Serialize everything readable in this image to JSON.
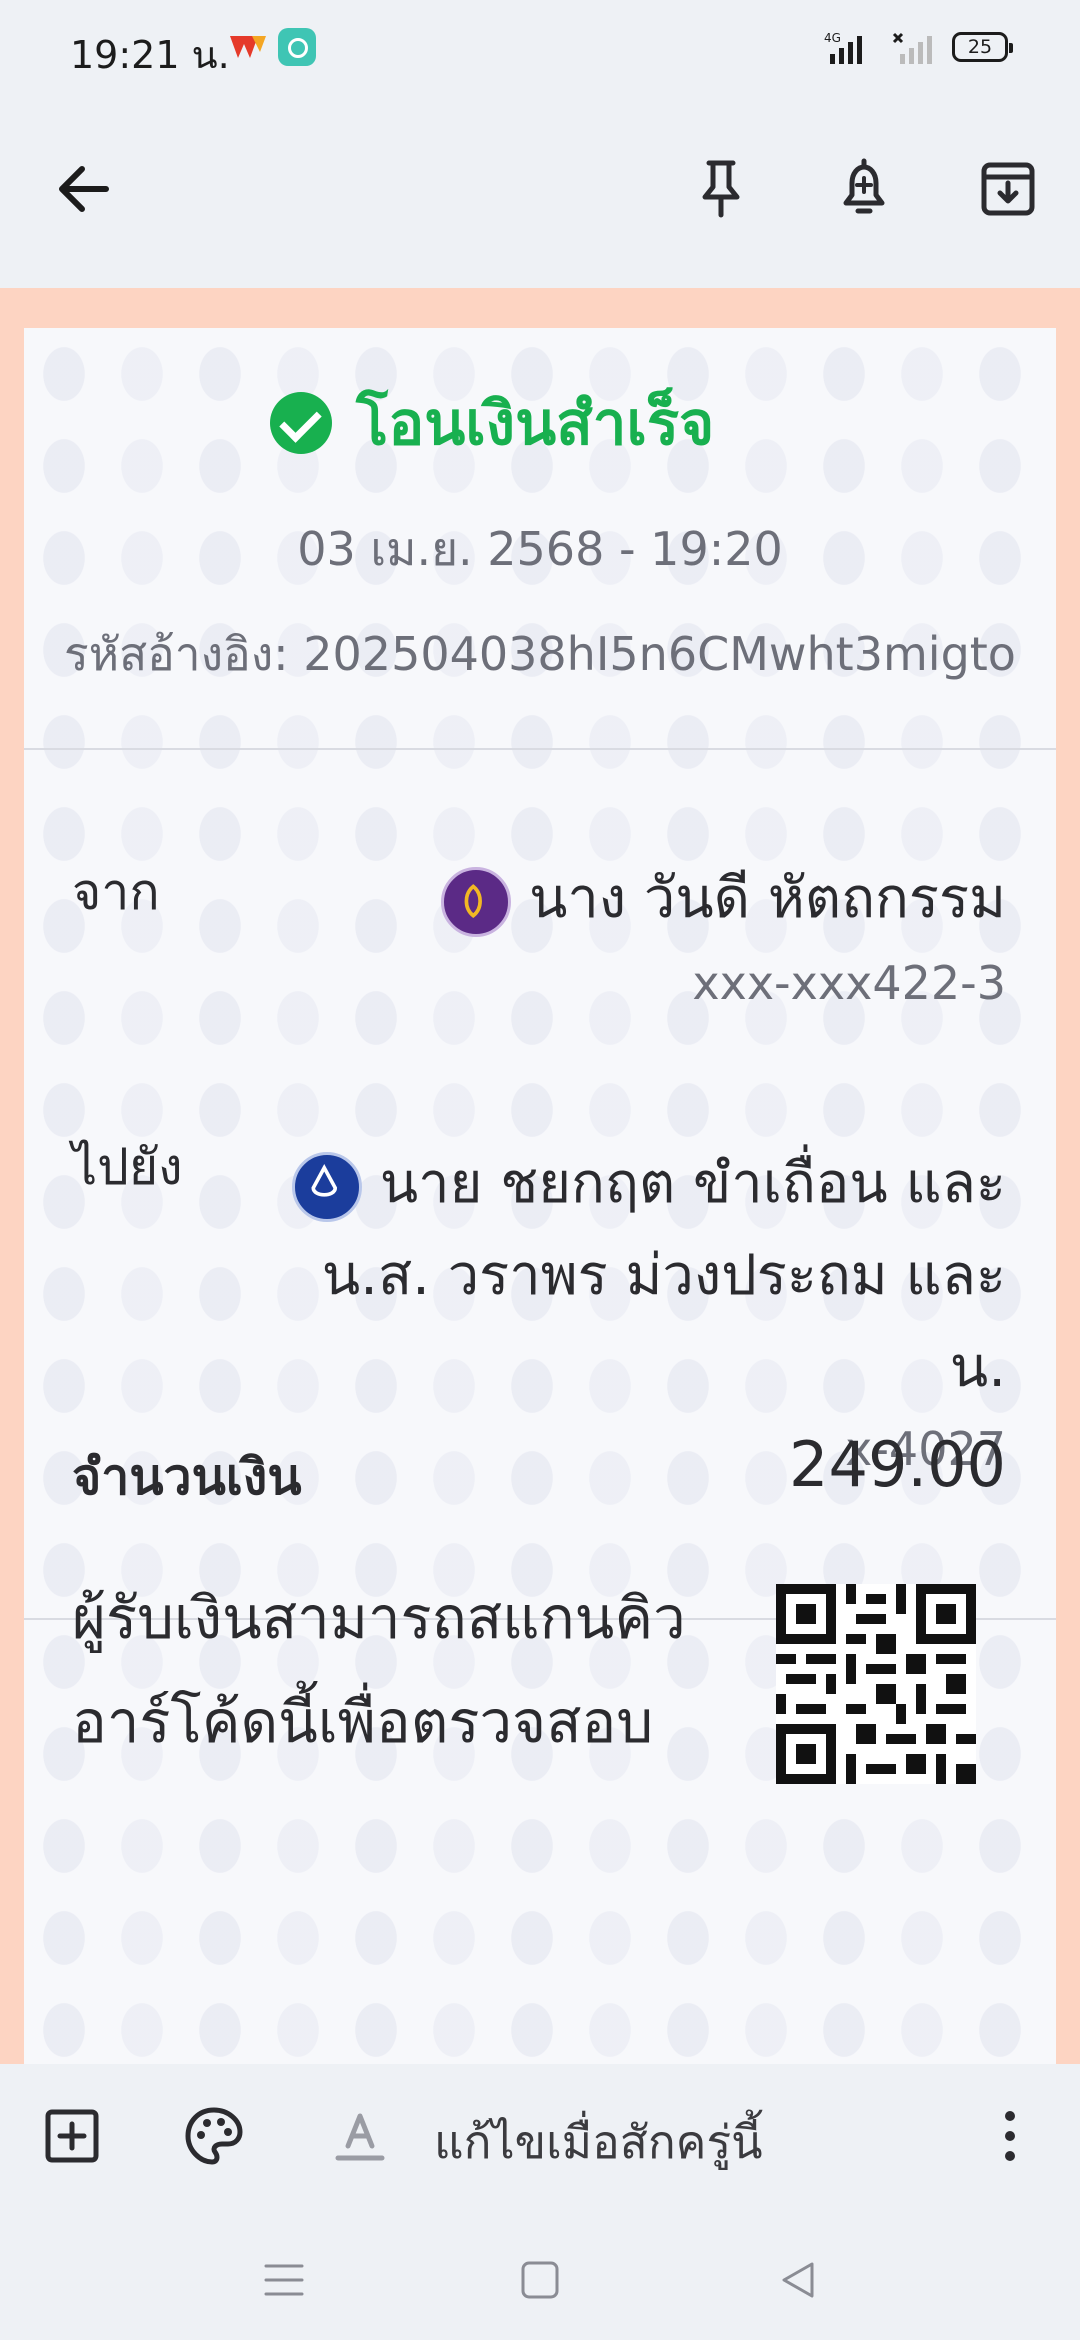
{
  "status_bar": {
    "time": "19:21 น.",
    "network": "4G",
    "battery": "25"
  },
  "app_bar": {
    "back": "back-arrow-icon",
    "actions": [
      "pin-icon",
      "reminder-bell-icon",
      "archive-icon"
    ]
  },
  "slip": {
    "status_title": "โอนเงินสำเร็จ",
    "datetime": "03 เม.ย. 2568 - 19:20",
    "reference": "รหัสอ้างอิง: 202504038hI5n6CMwht3migto",
    "from": {
      "label": "จาก",
      "name": "นาง วันดี หัตถกรรม",
      "account": "xxx-xxx422-3"
    },
    "to": {
      "label": "ไปยัง",
      "name_line1": "นาย ชยกฤต ขำเถื่อน และ",
      "name_line2": "น.ส. วราพร ม่วงประถม และ",
      "name_line3": "น.",
      "account": "x-4027"
    },
    "amount_label": "จำนวนเงิน",
    "amount": "249.00",
    "verify_line1": "ผู้รับเงินสามารถสแกนคิว",
    "verify_line2": "อาร์โค้ดนี้เพื่อตรวจสอบ"
  },
  "toolbar": {
    "edited_hint": "แก้ไขเมื่อสักครู่นี้"
  },
  "colors": {
    "success": "#18b04f",
    "note_background": "#fdd4c2",
    "chrome": "#eef1f5"
  }
}
